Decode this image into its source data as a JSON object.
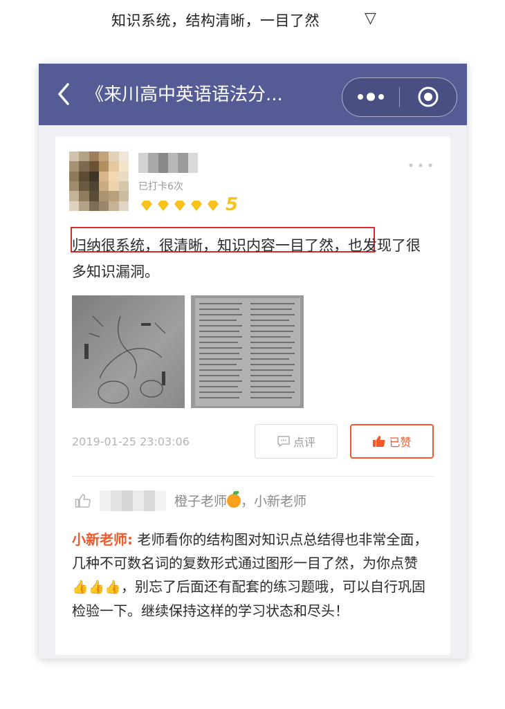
{
  "caption": {
    "text": "知识系统，结构清晰，一目了然",
    "arrow": "▽"
  },
  "navbar": {
    "title": "《来川高中英语语法分...",
    "background": "#545b95"
  },
  "post": {
    "checkin_text": "已打卡6次",
    "star_count": "5",
    "stars_filled": 5,
    "text_highlighted": "归纳很系统，很清晰，知识内容一目了然，",
    "text_rest": "也发现了很多知识漏洞。",
    "timestamp": "2019-01-25 23:03:06",
    "comment_label": "点评",
    "like_label": "已赞"
  },
  "likers": {
    "names": "橙子老师",
    "names_rest": "，小新老师"
  },
  "reply": {
    "teacher": "小新老师:",
    "text_part1": " 老师看你的结构图对知识点总结得也非常全面，几种不可数名词的复数形式通过图形一目了然，为你点赞",
    "thumbs": "👍👍👍",
    "text_part2": "，别忘了后面还有配套的练习题哦，可以自行巩固检验一下。继续保持这样的学习状态和尽头！"
  },
  "colors": {
    "accent": "#ef5a2a",
    "highlight_border": "#e3262a",
    "star": "#f7c21b"
  }
}
